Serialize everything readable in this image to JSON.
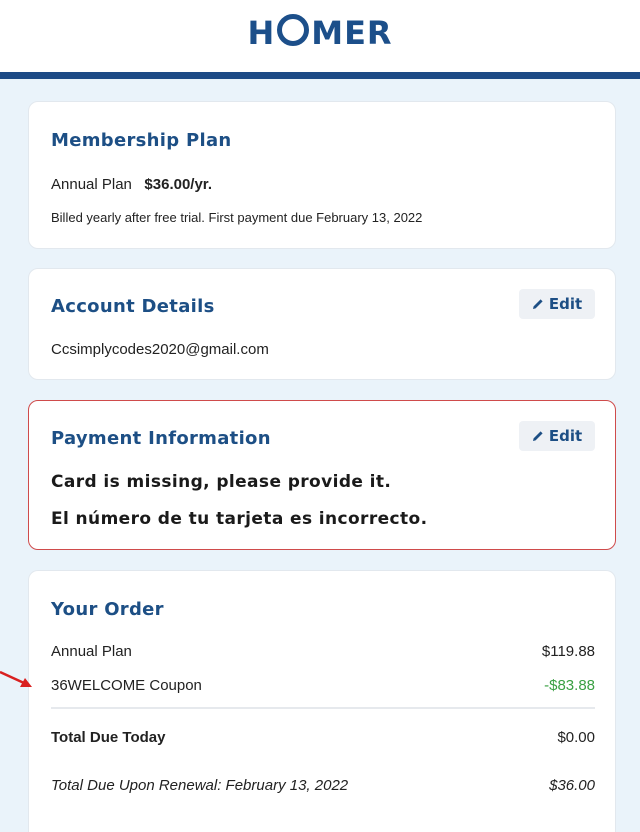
{
  "header": {
    "logo_pre": "H",
    "logo_post": "MER"
  },
  "membership": {
    "title": "Membership Plan",
    "plan_label": "Annual Plan",
    "plan_price": "$36.00/yr.",
    "billing_note": "Billed yearly after free trial. First payment due February 13, 2022"
  },
  "account": {
    "title": "Account Details",
    "edit_label": "Edit",
    "email": "Ccsimplycodes2020@gmail.com"
  },
  "payment": {
    "title": "Payment Information",
    "edit_label": "Edit",
    "error_1": "Card is missing, please provide it.",
    "error_2": "El número de tu tarjeta es incorrecto."
  },
  "order": {
    "title": "Your Order",
    "items": [
      {
        "label": "Annual Plan",
        "amount": "$119.88"
      },
      {
        "label": "36WELCOME Coupon",
        "amount": "-$83.88"
      }
    ],
    "total_label": "Total Due Today",
    "total_amount": "$0.00",
    "renewal_label": "Total Due Upon Renewal: February 13, 2022",
    "renewal_amount": "$36.00"
  },
  "colors": {
    "brand": "#1d4f85",
    "error_border": "#cf4b4b",
    "discount": "#3aa043",
    "arrow": "#d92020"
  },
  "icons": {
    "edit": "pencil-icon",
    "annotation": "red-arrow-icon"
  }
}
